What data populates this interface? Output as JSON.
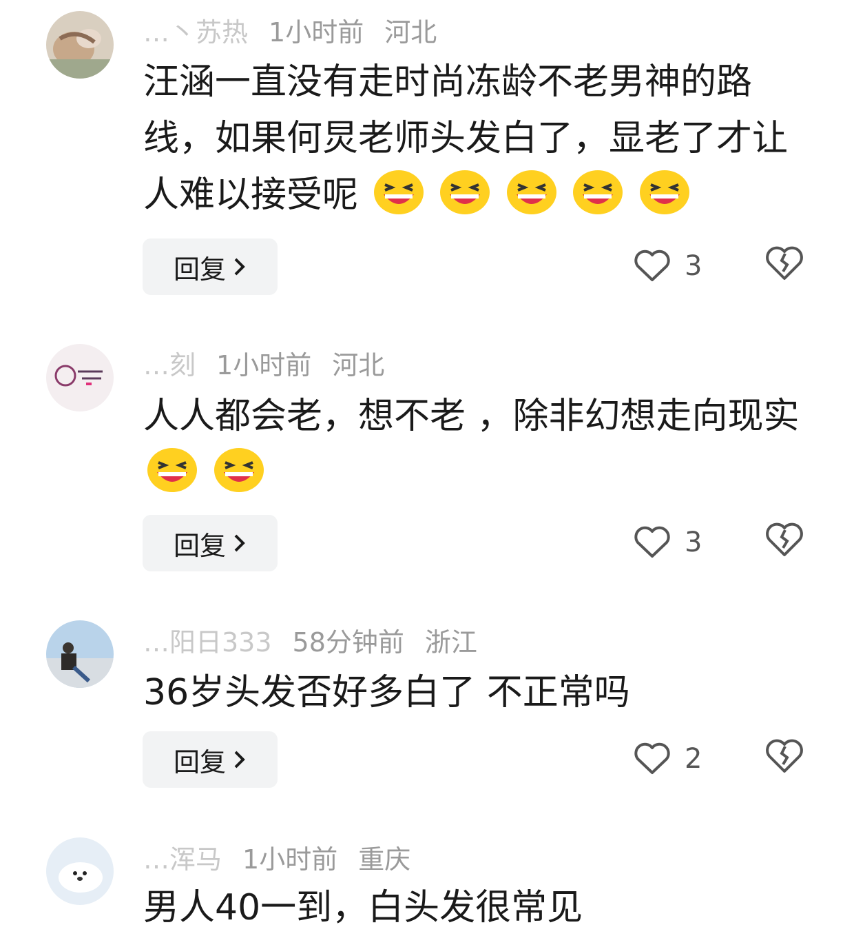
{
  "comments": [
    {
      "username": "…丶苏热",
      "time": "1小时前",
      "location": "河北",
      "text": "汪涵一直没有走时尚冻龄不老男神的路线，如果何炅老师头发白了，显老了才让人难以接受呢",
      "reply_label": "回复",
      "likes": "3"
    },
    {
      "username": "…刻",
      "time": "1小时前",
      "location": "河北",
      "text": "人人都会老，想不老 ，除非幻想走向现实",
      "reply_label": "回复",
      "likes": "3"
    },
    {
      "username": "…阳日333",
      "time": "58分钟前",
      "location": "浙江",
      "text": "36岁头发否好多白了 不正常吗",
      "reply_label": "回复",
      "likes": "2"
    },
    {
      "username": "…浑马",
      "time": "1小时前",
      "location": "重庆",
      "text": "男人40一到，白头发很常见"
    }
  ],
  "icons": {
    "reply_chevron": "chevron-right-icon",
    "like": "heart-outline-icon",
    "dislike": "broken-heart-icon",
    "emoji": "laughing-emoji-icon"
  },
  "colors": {
    "meta_text": "#9a9a9a",
    "body_text": "#1a1a1a",
    "button_bg": "#f2f3f4",
    "emoji_yellow": "#ffd020"
  }
}
